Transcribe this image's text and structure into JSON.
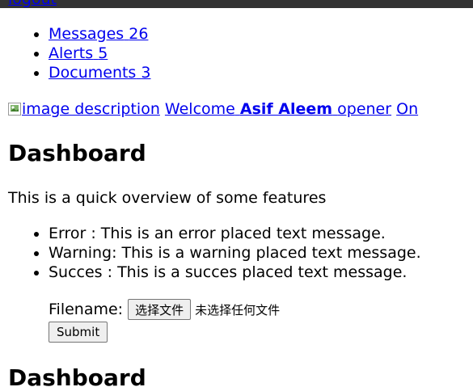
{
  "header": {
    "logout_label": "logout"
  },
  "nav": {
    "items": [
      {
        "label": "Messages",
        "count": "26"
      },
      {
        "label": "Alerts",
        "count": "5"
      },
      {
        "label": "Documents",
        "count": "3"
      }
    ]
  },
  "user_bar": {
    "image_alt": "image description",
    "welcome": "Welcome",
    "name": "Asif Aleem",
    "opener": "opener",
    "status": "On"
  },
  "main": {
    "title": "Dashboard",
    "intro": "This is a quick overview of some features",
    "messages": [
      "Error : This is an error placed text message.",
      "Warning: This is a warning placed text message.",
      "Succes : This is a succes placed text message."
    ],
    "form": {
      "filename_label": "Filename:",
      "choose_file": "选择文件",
      "no_file": "未选择任何文件",
      "submit": "Submit"
    },
    "second_title": "Dashboard"
  },
  "colors": {
    "topbar": "#333333",
    "link": "#0000ee"
  }
}
